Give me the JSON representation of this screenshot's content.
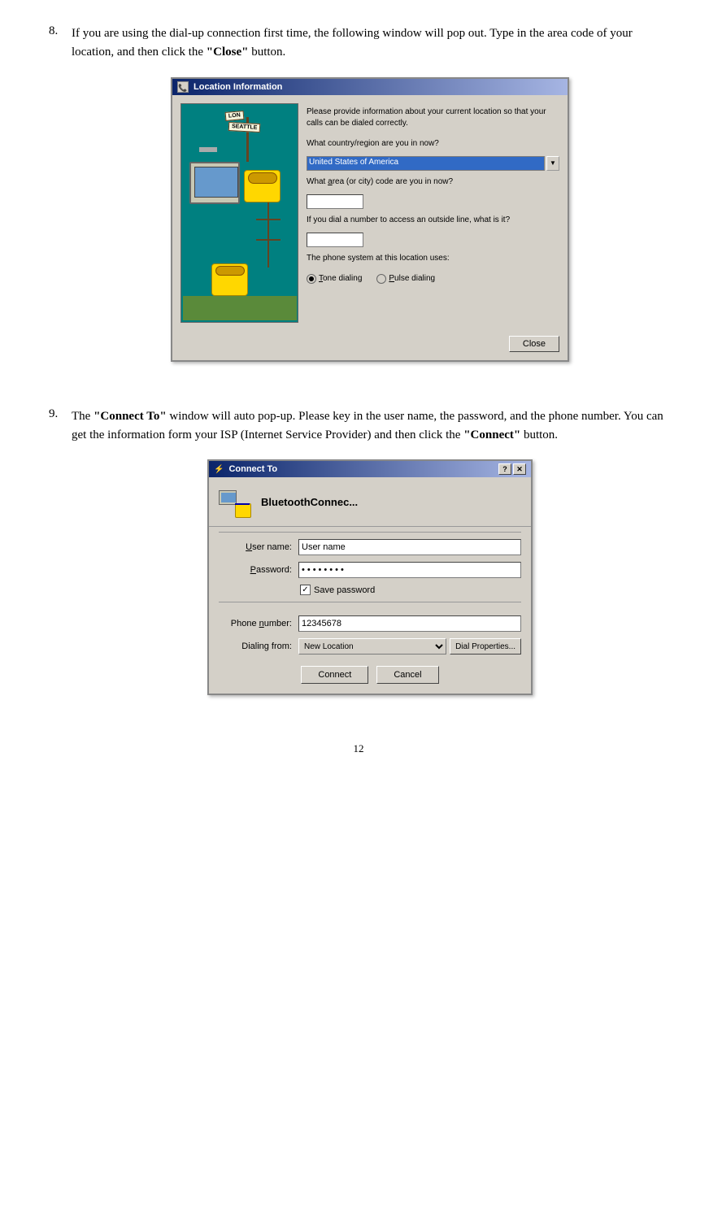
{
  "steps": [
    {
      "number": "8.",
      "text_parts": [
        {
          "text": "If you are using the dial-up connection first time, the following window will pop out. Type in the area code of your location, and then click the "
        },
        {
          "text": "\"Close\"",
          "bold": true
        },
        {
          "text": " button."
        }
      ]
    },
    {
      "number": "9.",
      "text_parts": [
        {
          "text": "The "
        },
        {
          "text": "\"Connect To\"",
          "bold": true
        },
        {
          "text": " window will auto pop-up. Please key in the user name, the password, and the phone number. You can get the information form your ISP (Internet Service Provider) and then click the "
        },
        {
          "text": "\"Connect\"",
          "bold": true
        },
        {
          "text": " button."
        }
      ]
    }
  ],
  "location_dialog": {
    "title": "Location Information",
    "description": "Please provide information about your current location so that your calls can be dialed correctly.",
    "country_label": "What country/region are you in now?",
    "country_value": "United States of America",
    "area_label": "What area (or city) code are you in now?",
    "outside_label": "If you dial a number to access an outside line, what is it?",
    "phone_system_label": "The phone system at this location uses:",
    "tone_label": "Tone dialing",
    "pulse_label": "Pulse dialing",
    "close_button": "Close",
    "signs": {
      "london": "LON",
      "seattle": "SEATTLE"
    }
  },
  "connect_dialog": {
    "title": "Connect To",
    "connection_name": "BluetoothConnec...",
    "user_name_label": "User name:",
    "user_name_value": "User name",
    "password_label": "Password:",
    "password_value": "••••••••",
    "save_password_label": "Save password",
    "phone_label": "Phone number:",
    "phone_value": "12345678",
    "dialing_from_label": "Dialing from:",
    "dialing_from_value": "New Location",
    "dial_properties_button": "Dial Properties...",
    "connect_button": "Connect",
    "cancel_button": "Cancel"
  },
  "page_number": "12"
}
